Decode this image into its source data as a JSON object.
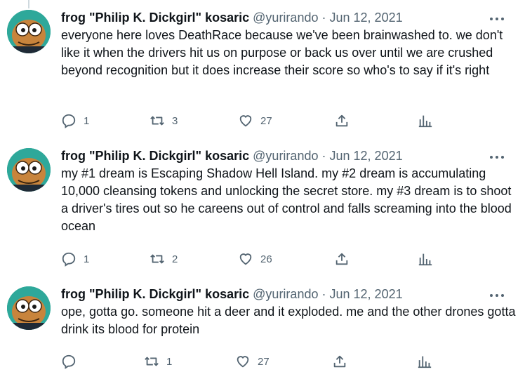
{
  "tweets": [
    {
      "author_name": "frog \"Philip K. Dickgirl\" kosaric",
      "handle": "@yurirando",
      "date": "Jun 12, 2021",
      "text": "everyone here loves DeathRace because we've been brainwashed to. we don't like it when the drivers hit us on purpose or back us over until we are crushed beyond recognition but it does increase their score so who's to say if it's right",
      "replies": "1",
      "retweets": "3",
      "likes": "27"
    },
    {
      "author_name": "frog \"Philip K. Dickgirl\" kosaric",
      "handle": "@yurirando",
      "date": "Jun 12, 2021",
      "text": "my #1 dream is Escaping Shadow Hell Island. my #2 dream is accumulating 10,000 cleansing tokens and unlocking the secret store. my #3 dream is to shoot a driver's tires out so he careens out of control and falls screaming into the blood ocean",
      "replies": "1",
      "retweets": "2",
      "likes": "26"
    },
    {
      "author_name": "frog \"Philip K. Dickgirl\" kosaric",
      "handle": "@yurirando",
      "date": "Jun 12, 2021",
      "text": "ope, gotta go. someone hit a deer and it exploded. me and the other drones gotta drink its blood for protein",
      "replies": "",
      "retweets": "1",
      "likes": "27"
    }
  ],
  "separator": "·",
  "icons": {
    "reply": "reply-icon",
    "retweet": "retweet-icon",
    "like": "heart-icon",
    "share": "share-icon",
    "analytics": "analytics-icon",
    "more": "more-icon"
  },
  "colors": {
    "text": "#0f1419",
    "secondary": "#536471",
    "avatar_bg": "#2ea89a",
    "thread_line": "#cfd9de"
  }
}
